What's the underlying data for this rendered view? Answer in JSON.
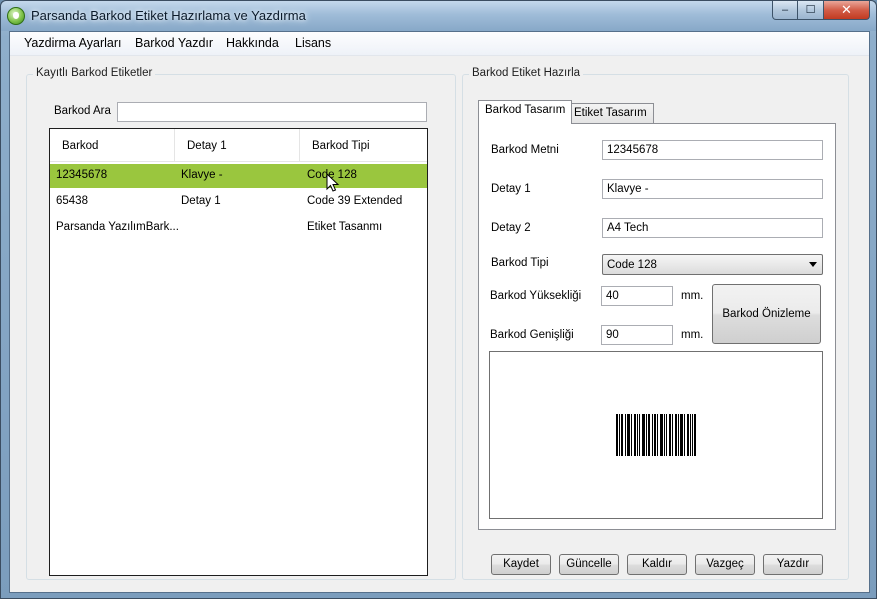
{
  "window": {
    "title": "Parsanda Barkod Etiket Hazırlama ve Yazdırma",
    "minimize_glyph": "–",
    "maximize_glyph": "☐",
    "close_glyph": "✕"
  },
  "menu": [
    "Yazdirma Ayarları",
    "Barkod Yazdır",
    "Hakkında",
    "Lisans"
  ],
  "left_group": {
    "title": "Kayıtlı Barkod Etiketler",
    "search_label": "Barkod Ara",
    "search_value": "",
    "columns": [
      "Barkod",
      "Detay 1",
      "Barkod Tipi"
    ],
    "rows": [
      {
        "barkod": "12345678",
        "detay": "Klavye -",
        "tip": "Code 128",
        "selected": true
      },
      {
        "barkod": "65438",
        "detay": "Detay 1",
        "tip": "Code 39 Extended",
        "selected": false
      },
      {
        "barkod": "Parsanda YazılımBark...",
        "detay": "",
        "tip": "Etiket Tasanmı",
        "selected": false
      }
    ],
    "selected_color": "#9ac63e"
  },
  "right_group": {
    "title": "Barkod Etiket Hazırla",
    "tabs": [
      "Barkod Tasarım",
      "Etiket Tasarım"
    ],
    "active_tab": "Barkod Tasarım",
    "fields": {
      "metin_label": "Barkod Metni",
      "metin_value": "12345678",
      "detay1_label": "Detay 1",
      "detay1_value": "Klavye -",
      "detay2_label": "Detay 2",
      "detay2_value": "A4 Tech",
      "tip_label": "Barkod Tipi",
      "tip_value": "Code 128",
      "yukseklik_label": "Barkod Yüksekliği",
      "yukseklik_value": "40",
      "genislik_label": "Barkod Genişliği",
      "genislik_value": "90",
      "unit": "mm."
    },
    "preview_button": "Barkod Önizleme",
    "bottom_buttons": [
      "Kaydet",
      "Güncelle",
      "Kaldır",
      "Vazgeç",
      "Yazdır"
    ]
  },
  "icons": {
    "app": "app-icon",
    "cursor": "mouse-pointer-icon",
    "dropdown": "chevron-down-icon"
  }
}
